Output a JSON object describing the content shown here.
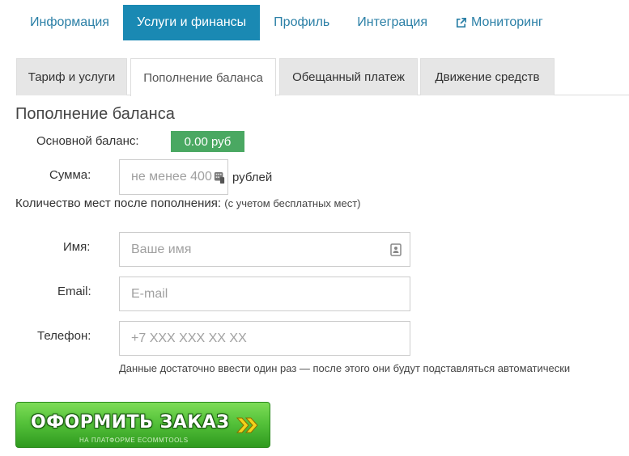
{
  "topnav": {
    "items": [
      {
        "label": "Информация",
        "active": false
      },
      {
        "label": "Услуги и финансы",
        "active": true
      },
      {
        "label": "Профиль",
        "active": false
      },
      {
        "label": "Интеграция",
        "active": false
      },
      {
        "label": "Мониторинг",
        "active": false,
        "icon": "external-link-icon"
      }
    ]
  },
  "subtabs": {
    "items": [
      {
        "label": "Тариф и услуги",
        "active": false
      },
      {
        "label": "Пополнение баланса",
        "active": true
      },
      {
        "label": "Обещанный платеж",
        "active": false
      },
      {
        "label": "Движение средств",
        "active": false
      }
    ]
  },
  "section_title": "Пополнение баланса",
  "balance": {
    "label": "Основной баланс:",
    "value": "0.00 руб"
  },
  "amount": {
    "label": "Сумма:",
    "placeholder": "не менее 400",
    "unit": "рублей",
    "icon": "calculator-icon"
  },
  "seats": {
    "label": "Количество мест после пополнения:",
    "note": "(с учетом бесплатных мест)"
  },
  "name_field": {
    "label": "Имя:",
    "placeholder": "Ваше имя",
    "icon": "contact-card-icon"
  },
  "email_field": {
    "label": "Email:",
    "placeholder": "E-mail"
  },
  "phone_field": {
    "label": "Телефон:",
    "placeholder": "+7 XXX XXX XX XX"
  },
  "hint": "Данные достаточно ввести один раз — после этого они будут подставляться автоматически",
  "order_button": {
    "label": "ОФОРМИТЬ ЗАКАЗ",
    "sublabel": "НА ПЛАТФОРМЕ ECOMMTOOLS",
    "icon": "double-chevron-right-icon"
  },
  "colors": {
    "accent": "#1a89b3",
    "link": "#2a7fa6",
    "badge": "#4aa862",
    "button": "#55c23a"
  }
}
